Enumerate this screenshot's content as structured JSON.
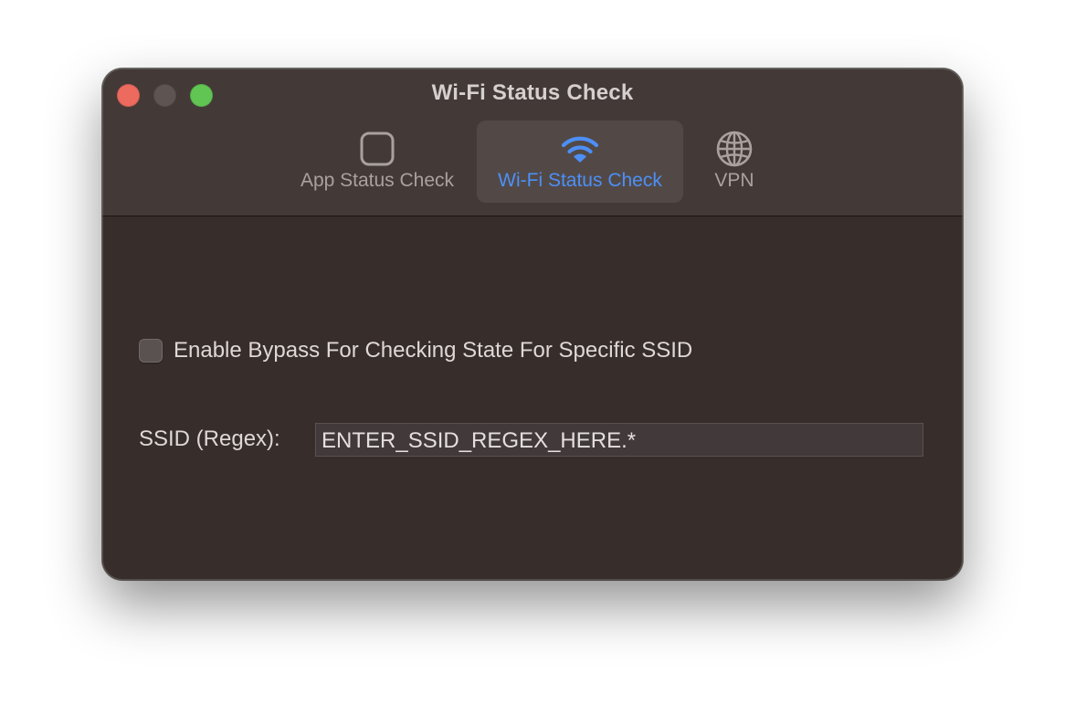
{
  "window": {
    "title": "Wi-Fi Status Check"
  },
  "toolbar": {
    "tabs": [
      {
        "label": "App Status Check",
        "icon": "app-square-icon",
        "selected": false
      },
      {
        "label": "Wi-Fi Status Check",
        "icon": "wifi-icon",
        "selected": true
      },
      {
        "label": "VPN",
        "icon": "globe-icon",
        "selected": false
      }
    ]
  },
  "bypass": {
    "checkbox_label": "Enable Bypass For Checking State For Specific SSID",
    "checked": false
  },
  "ssid": {
    "label": "SSID (Regex):",
    "value": "ENTER_SSID_REGEX_HERE.*"
  },
  "colors": {
    "accent": "#4d8ff5",
    "close": "#ec6a5e",
    "minimize": "#5e5553",
    "zoom": "#61c554",
    "window_bg": "#372d2a",
    "toolbar_bg": "#433a37"
  }
}
